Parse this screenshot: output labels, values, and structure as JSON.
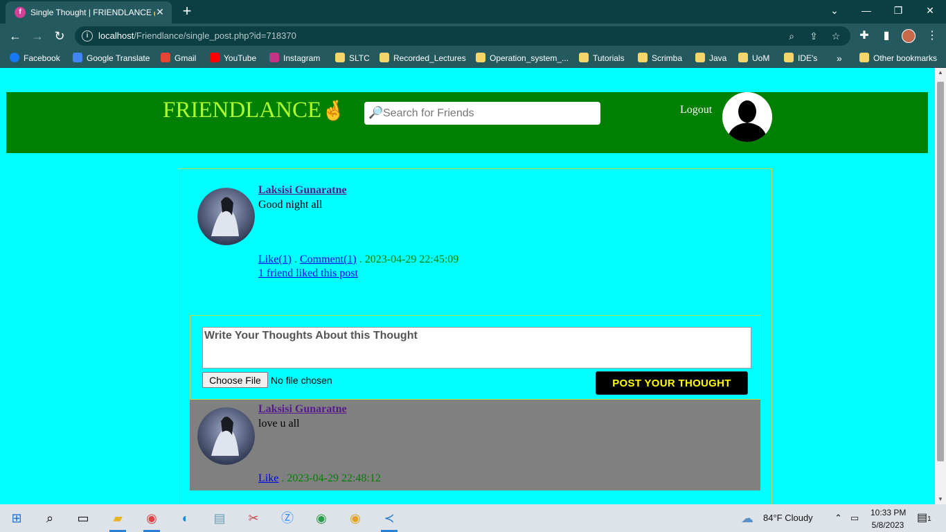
{
  "browser": {
    "tab_title": "Single Thought | FRIENDLANCE✌",
    "url_host": "localhost",
    "url_path": "/Friendlance/single_post.php?id=718370",
    "bookmarks": [
      "Facebook",
      "Google Translate",
      "Gmail",
      "YouTube",
      "Instagram",
      "SLTC",
      "Recorded_Lectures",
      "Operation_system_...",
      "Tutorials",
      "Scrimba",
      "Java",
      "UoM",
      "IDE's"
    ],
    "other_bookmarks": "Other bookmarks",
    "overflow": "»"
  },
  "header": {
    "brand": "FRIENDLANCE",
    "brand_emoji": "🤞",
    "search_placeholder": "Search for Friends",
    "logout": "Logout"
  },
  "post": {
    "author": "Laksisi Gunaratne",
    "text": "Good night all",
    "like_label": "Like(1)",
    "comment_label": "Comment(1)",
    "separator": " . ",
    "timestamp": "2023-04-29 22:45:09",
    "liked_summary": "1 friend liked this post"
  },
  "comment_form": {
    "placeholder": "Write Your Thoughts About this Thought",
    "choose_file": "Choose File",
    "no_file": "No file chosen",
    "submit": "POST YOUR THOUGHT"
  },
  "comment": {
    "author": "Laksisi Gunaratne",
    "text": "love u all",
    "like_label": "Like",
    "separator": " . ",
    "timestamp": "2023-04-29 22:48:12"
  },
  "taskbar": {
    "weather": "84°F  Cloudy",
    "time": "10:33 PM",
    "date": "5/8/2023",
    "notifications": "1"
  },
  "colors": {
    "page_bg": "#00ffff",
    "header_bg": "#008000",
    "brand": "#adff2f",
    "comment_bg": "#808080",
    "button_bg": "#000000",
    "button_text": "#ffff00"
  }
}
